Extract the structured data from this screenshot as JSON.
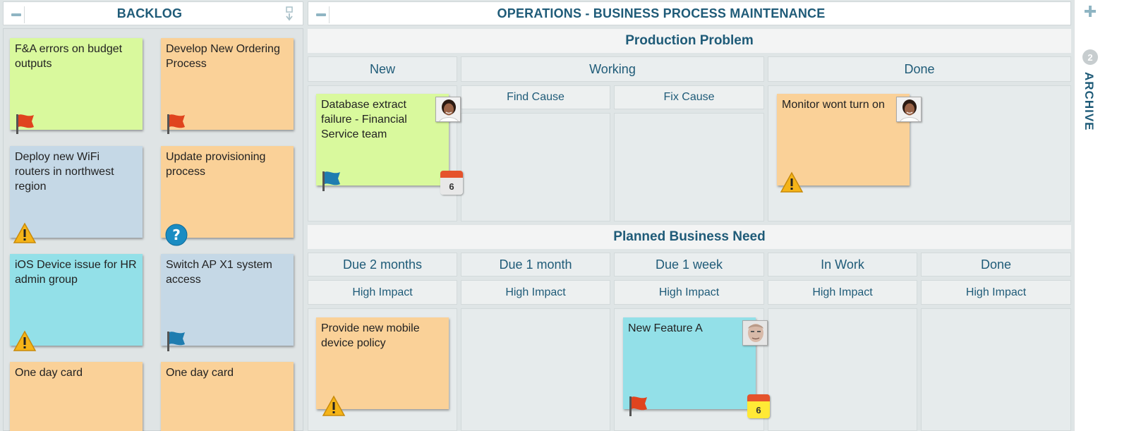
{
  "backlog": {
    "title": "BACKLOG",
    "cards": [
      {
        "text": "F&A errors on budget outputs",
        "color": "green",
        "icon": "red-flag-icon"
      },
      {
        "text": "Develop New Ordering Process",
        "color": "orange",
        "icon": "red-flag-icon"
      },
      {
        "text": "Deploy new WiFi routers in northwest region",
        "color": "blue",
        "icon": "warning-icon"
      },
      {
        "text": "Update provisioning process",
        "color": "orange",
        "icon": "question-icon"
      },
      {
        "text": "iOS Device issue for HR admin group",
        "color": "cyan",
        "icon": "warning-icon"
      },
      {
        "text": "Switch AP X1 system access",
        "color": "blue",
        "icon": "blue-flag-icon"
      },
      {
        "text": "One day card",
        "color": "orange"
      },
      {
        "text": "One day card",
        "color": "orange"
      }
    ]
  },
  "board": {
    "title": "OPERATIONS - BUSINESS PROCESS MAINTENANCE",
    "production": {
      "title": "Production Problem",
      "columns": {
        "new": "New",
        "working": "Working",
        "find_cause": "Find Cause",
        "fix_cause": "Fix Cause",
        "done": "Done"
      },
      "cards": {
        "db": {
          "text": "Database extract failure - Financial Service team",
          "calendar": "6"
        },
        "monitor": {
          "text": "Monitor wont turn on"
        }
      }
    },
    "planned": {
      "title": "Planned Business Need",
      "columns": [
        "Due 2 months",
        "Due 1 month",
        "Due 1 week",
        "In Work",
        "Done"
      ],
      "impact": "High Impact",
      "cards": {
        "mobile": {
          "text": "Provide new mobile device policy"
        },
        "feature": {
          "text": "New Feature A",
          "calendar": "6"
        }
      }
    }
  },
  "archive": {
    "label": "ARCHIVE",
    "count": "2"
  },
  "colors": {
    "header_text": "#1f5b78",
    "card_green": "#d9f99d",
    "card_orange": "#fad198",
    "card_blue": "#c5d8e6",
    "card_cyan": "#93e0e8"
  }
}
